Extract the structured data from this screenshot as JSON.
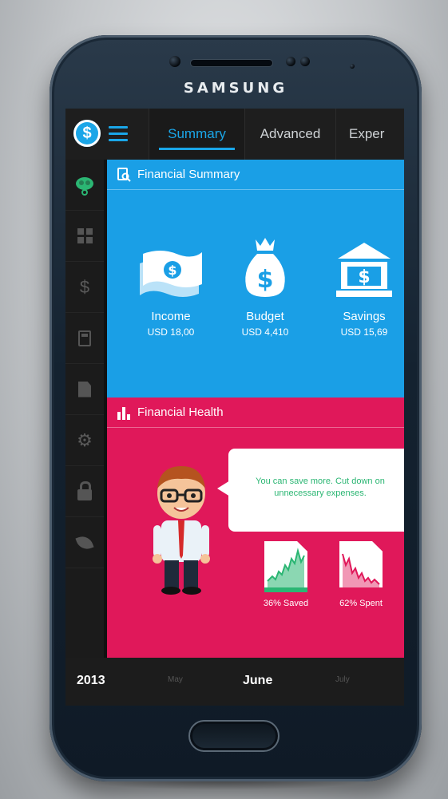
{
  "device": {
    "brand": "SAMSUNG"
  },
  "app": {
    "logo_glyph": "$",
    "accent_color": "#1aa6e8",
    "tabs": [
      {
        "label": "Summary",
        "active": true
      },
      {
        "label": "Advanced",
        "active": false
      },
      {
        "label": "Exper",
        "active": false
      }
    ],
    "sidebar": [
      {
        "icon": "brain-icon",
        "active": true
      },
      {
        "icon": "grid-icon"
      },
      {
        "icon": "dollar-icon",
        "glyph": "$"
      },
      {
        "icon": "calculator-icon"
      },
      {
        "icon": "document-icon"
      },
      {
        "icon": "gear-icon",
        "glyph": "⚙"
      },
      {
        "icon": "lock-icon"
      },
      {
        "icon": "leaf-icon"
      }
    ]
  },
  "summary": {
    "title": "Financial Summary",
    "color": "#1a9fe6",
    "stats": [
      {
        "name": "Income",
        "value": "USD 18,00",
        "icon": "money-icon"
      },
      {
        "name": "Budget",
        "value": "USD 4,410",
        "icon": "money-bag-icon"
      },
      {
        "name": "Savings",
        "value": "USD 15,69",
        "icon": "bank-icon"
      }
    ]
  },
  "health": {
    "title": "Financial Health",
    "color": "#e0185a",
    "message": "You can save more. Cut down on unnecessary expenses.",
    "saved": {
      "label": "36% Saved",
      "percent": 36,
      "color": "#2bb673"
    },
    "spent": {
      "label": "62% Spent",
      "percent": 62,
      "color": "#e0185a"
    }
  },
  "timeline": {
    "year": "2013",
    "prev_month": "May",
    "current_month": "June",
    "next_month": "July"
  }
}
